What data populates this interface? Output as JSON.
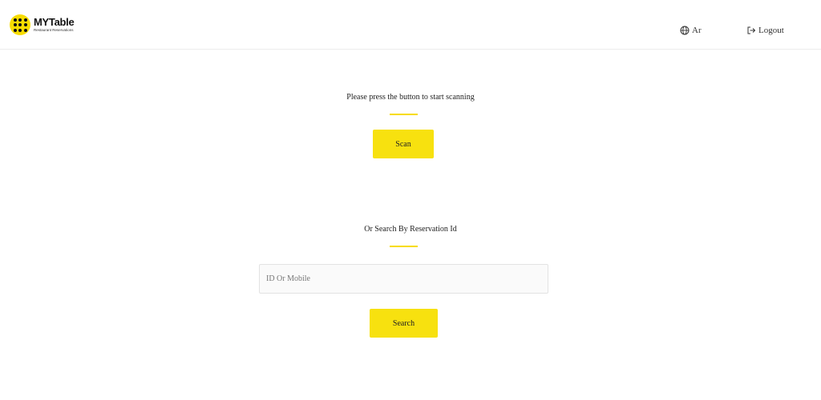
{
  "header": {
    "logo_name": "MYTable",
    "logo_subtitle": "Restaurant Reservations",
    "language_label": "Ar",
    "logout_label": "Logout"
  },
  "scan_section": {
    "instruction": "Please press the button to start scanning",
    "button_label": "Scan"
  },
  "search_section": {
    "title": "Or Search By Reservation Id",
    "input_placeholder": "ID Or Mobile",
    "input_value": "",
    "button_label": "Search"
  },
  "colors": {
    "accent": "#f7e10f",
    "border": "#e3e3e3"
  },
  "icons": {
    "language": "globe-icon",
    "logout": "logout-icon",
    "logo": "dots-grid-icon"
  }
}
